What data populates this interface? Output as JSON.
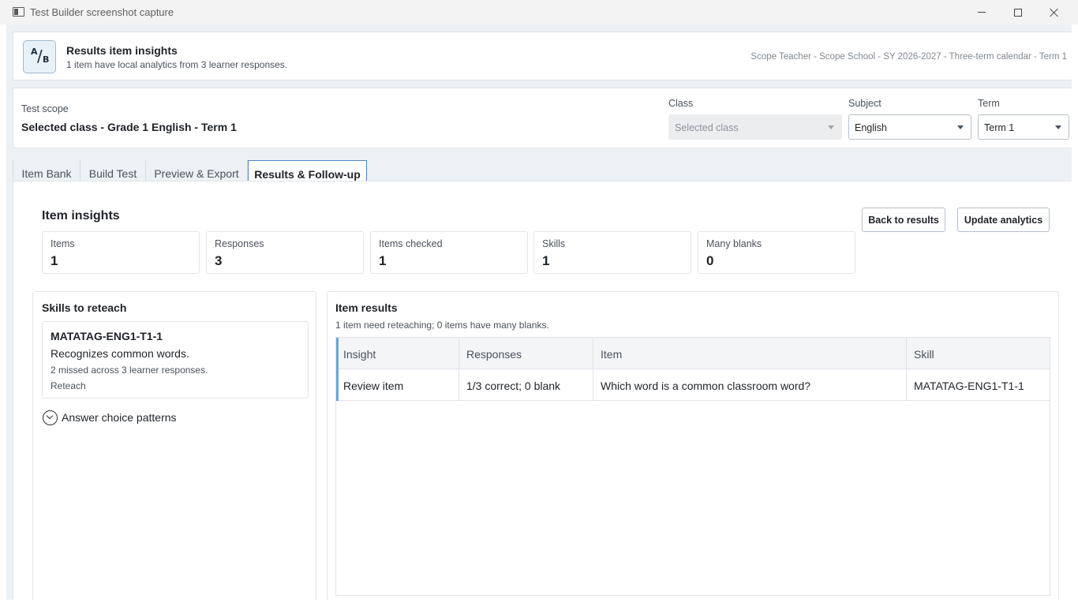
{
  "window": {
    "title": "Test Builder screenshot capture"
  },
  "header": {
    "logo_text": [
      "A",
      "/",
      "B"
    ],
    "title": "Results item insights",
    "subtitle": "1 item have local analytics from 3 learner responses.",
    "context": "Scope Teacher - Scope School - SY 2026-2027 - Three-term calendar - Term 1"
  },
  "scope": {
    "label": "Test scope",
    "value": "Selected class - Grade 1 English - Term 1",
    "class": {
      "label": "Class",
      "value": "Selected class"
    },
    "subject": {
      "label": "Subject",
      "value": "English"
    },
    "term": {
      "label": "Term",
      "value": "Term 1"
    }
  },
  "tabs": [
    {
      "label": "Item Bank"
    },
    {
      "label": "Build Test"
    },
    {
      "label": "Preview & Export"
    },
    {
      "label": "Results & Follow-up",
      "active": true
    }
  ],
  "insights": {
    "title": "Item insights",
    "back_label": "Back to results",
    "update_label": "Update analytics",
    "stats": [
      {
        "label": "Items",
        "value": "1"
      },
      {
        "label": "Responses",
        "value": "3"
      },
      {
        "label": "Items checked",
        "value": "1"
      },
      {
        "label": "Skills",
        "value": "1"
      },
      {
        "label": "Many blanks",
        "value": "0"
      }
    ]
  },
  "reteach": {
    "title": "Skills to reteach",
    "skill_code": "MATATAG-ENG1-T1-1",
    "skill_desc": "Recognizes common words.",
    "skill_missed": "2 missed across 3 learner responses.",
    "skill_action": "Reteach",
    "patterns_label": "Answer choice patterns"
  },
  "results": {
    "title": "Item results",
    "subtitle": "1 item need reteaching; 0 items have many blanks.",
    "columns": [
      "Insight",
      "Responses",
      "Item",
      "Skill"
    ],
    "rows": [
      [
        "Review item",
        "1/3 correct; 0 blank",
        "Which word is a common classroom word?",
        "MATATAG-ENG1-T1-1"
      ]
    ]
  },
  "colors": {
    "accent": "#6ea4d8",
    "tab_border": "#4d87c7",
    "app_bg": "#edf1f5"
  }
}
